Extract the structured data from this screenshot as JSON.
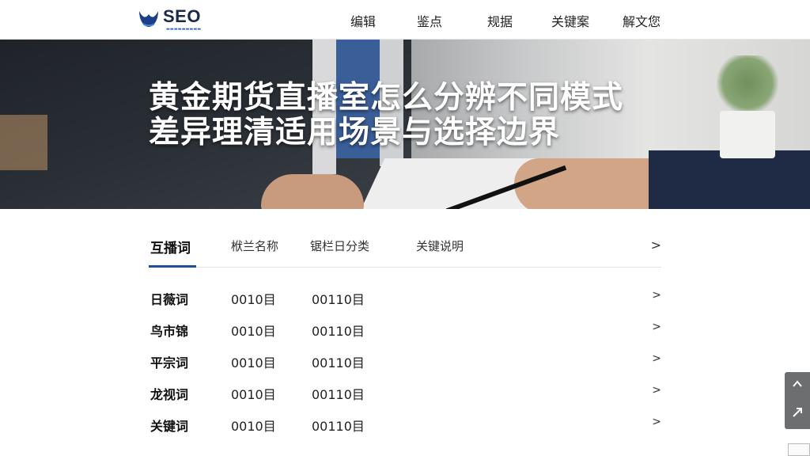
{
  "header": {
    "logo_text": "SEO",
    "logo_icon": "wave-logo-icon",
    "nav": [
      "编辑",
      "鉴点",
      "规据",
      "关键案",
      "解文您"
    ]
  },
  "hero": {
    "title_line1": "黄金期货直播室怎么分辨不同模式",
    "title_line2": "差异理清适用场景与选择边界"
  },
  "table": {
    "tabs": [
      "互播词",
      "栿兰名称",
      "锯栏日分类",
      "关键说明"
    ],
    "rows": [
      [
        "日薇词",
        "0010目",
        "00110目"
      ],
      [
        "鸟市锦",
        "0010目",
        "00110目"
      ],
      [
        "平宗词",
        "0010目",
        "00110目"
      ],
      [
        "龙视词",
        "0010目",
        "00110目"
      ],
      [
        "关键词",
        "0010目",
        "00110目"
      ]
    ],
    "chevron": ">"
  },
  "side_widget": {
    "up_icon": "chevron-up-icon",
    "share_icon": "share-icon"
  },
  "colors": {
    "accent": "#1f4f9a",
    "header_bg": "#ffffff",
    "widget_bg": "#6d6e70"
  }
}
